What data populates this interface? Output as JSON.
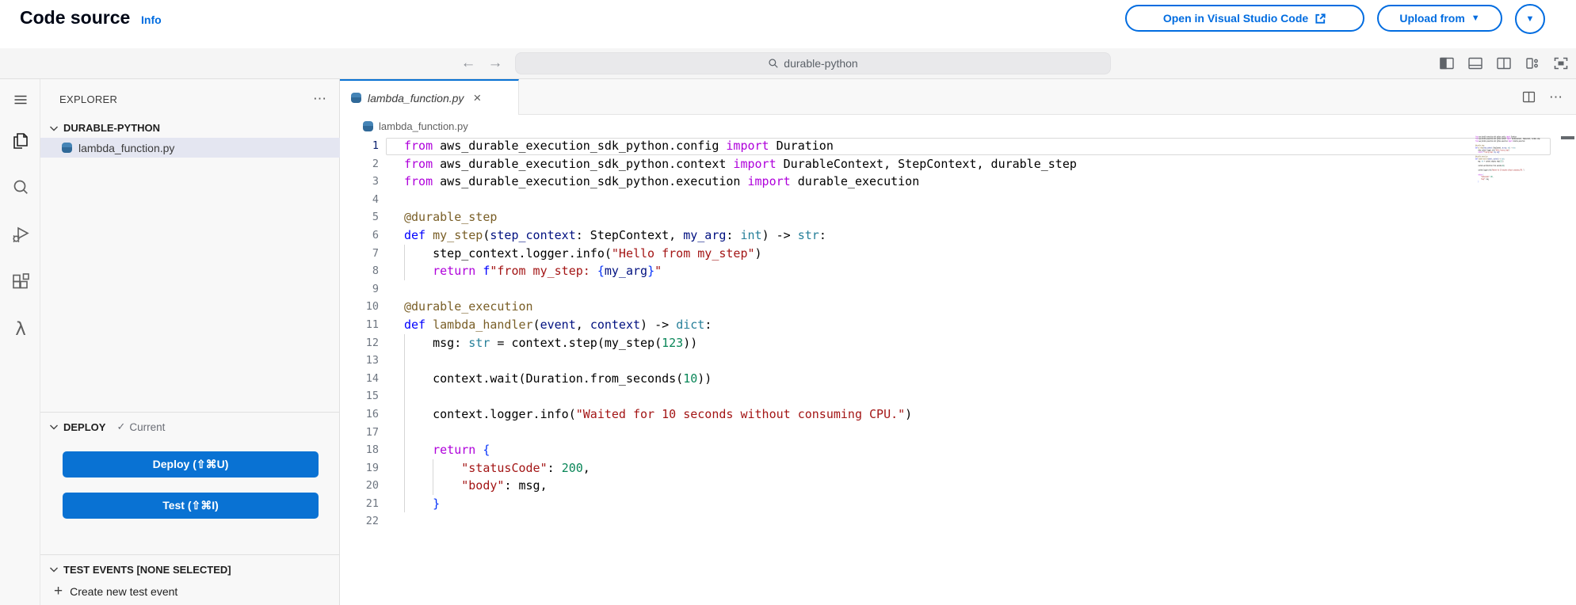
{
  "header": {
    "title": "Code source",
    "info": "Info",
    "open_vsc_label": "Open in Visual Studio Code",
    "upload_label": "Upload from"
  },
  "toolbar": {
    "search_value": "durable-python"
  },
  "icons": {
    "back_arrow": "←",
    "forward_arrow": "→",
    "more_horizontal": "⋯",
    "close": "×",
    "check": "✓",
    "plus": "+",
    "caret_down": "▼",
    "lambda": "λ"
  },
  "sidebar": {
    "explorer": "EXPLORER",
    "workspace": "DURABLE-PYTHON",
    "file": "lambda_function.py",
    "deploy_section": "DEPLOY",
    "deploy_status": "Current",
    "deploy_button": "Deploy (⇧⌘U)",
    "test_button": "Test (⇧⌘I)",
    "test_events_section": "TEST EVENTS [NONE SELECTED]",
    "create_test_event": "Create new test event"
  },
  "editor": {
    "tab": "lambda_function.py",
    "breadcrumb": "lambda_function.py",
    "palette": {
      "kc": "#AF00DB",
      "kw": "#0000FF",
      "fn": "#795E26",
      "ty": "#267F99",
      "pm": "#001080",
      "st": "#A31515",
      "nu": "#098658",
      "bk": "#0431FA",
      "pl": "#000000"
    },
    "lines": [
      {
        "n": 1,
        "current": true,
        "g": 0,
        "t": [
          [
            "kc",
            "from"
          ],
          [
            "pl",
            " aws_durable_execution_sdk_python.config "
          ],
          [
            "kc",
            "import"
          ],
          [
            "pl",
            " Duration"
          ]
        ]
      },
      {
        "n": 2,
        "g": 0,
        "t": [
          [
            "kc",
            "from"
          ],
          [
            "pl",
            " aws_durable_execution_sdk_python.context "
          ],
          [
            "kc",
            "import"
          ],
          [
            "pl",
            " DurableContext, StepContext, durable_step"
          ]
        ]
      },
      {
        "n": 3,
        "g": 0,
        "t": [
          [
            "kc",
            "from"
          ],
          [
            "pl",
            " aws_durable_execution_sdk_python.execution "
          ],
          [
            "kc",
            "import"
          ],
          [
            "pl",
            " durable_execution"
          ]
        ]
      },
      {
        "n": 4,
        "g": 0,
        "t": []
      },
      {
        "n": 5,
        "g": 0,
        "t": [
          [
            "fn",
            "@durable_step"
          ]
        ]
      },
      {
        "n": 6,
        "g": 0,
        "t": [
          [
            "kw",
            "def"
          ],
          [
            "pl",
            " "
          ],
          [
            "fn",
            "my_step"
          ],
          [
            "pl",
            "("
          ],
          [
            "pm",
            "step_context"
          ],
          [
            "pl",
            ": StepContext, "
          ],
          [
            "pm",
            "my_arg"
          ],
          [
            "pl",
            ": "
          ],
          [
            "ty",
            "int"
          ],
          [
            "pl",
            ") -> "
          ],
          [
            "ty",
            "str"
          ],
          [
            "pl",
            ":"
          ]
        ]
      },
      {
        "n": 7,
        "g": 1,
        "t": [
          [
            "pl",
            "    step_context.logger.info("
          ],
          [
            "st",
            "\"Hello from my_step\""
          ],
          [
            "pl",
            ")"
          ]
        ]
      },
      {
        "n": 8,
        "g": 1,
        "t": [
          [
            "pl",
            "    "
          ],
          [
            "kc",
            "return"
          ],
          [
            "pl",
            " "
          ],
          [
            "kw",
            "f"
          ],
          [
            "st",
            "\"from my_step: "
          ],
          [
            "bk",
            "{"
          ],
          [
            "pm",
            "my_arg"
          ],
          [
            "bk",
            "}"
          ],
          [
            "st",
            "\""
          ]
        ]
      },
      {
        "n": 9,
        "g": 0,
        "t": []
      },
      {
        "n": 10,
        "g": 0,
        "t": [
          [
            "fn",
            "@durable_execution"
          ]
        ]
      },
      {
        "n": 11,
        "g": 0,
        "t": [
          [
            "kw",
            "def"
          ],
          [
            "pl",
            " "
          ],
          [
            "fn",
            "lambda_handler"
          ],
          [
            "pl",
            "("
          ],
          [
            "pm",
            "event"
          ],
          [
            "pl",
            ", "
          ],
          [
            "pm",
            "context"
          ],
          [
            "pl",
            ") -> "
          ],
          [
            "ty",
            "dict"
          ],
          [
            "pl",
            ":"
          ]
        ]
      },
      {
        "n": 12,
        "g": 1,
        "t": [
          [
            "pl",
            "    msg: "
          ],
          [
            "ty",
            "str"
          ],
          [
            "pl",
            " = context.step(my_step("
          ],
          [
            "nu",
            "123"
          ],
          [
            "pl",
            "))"
          ]
        ]
      },
      {
        "n": 13,
        "g": 1,
        "t": []
      },
      {
        "n": 14,
        "g": 1,
        "t": [
          [
            "pl",
            "    context.wait(Duration.from_seconds("
          ],
          [
            "nu",
            "10"
          ],
          [
            "pl",
            "))"
          ]
        ]
      },
      {
        "n": 15,
        "g": 1,
        "t": []
      },
      {
        "n": 16,
        "g": 1,
        "t": [
          [
            "pl",
            "    context.logger.info("
          ],
          [
            "st",
            "\"Waited for 10 seconds without consuming CPU.\""
          ],
          [
            "pl",
            ")"
          ]
        ]
      },
      {
        "n": 17,
        "g": 1,
        "t": []
      },
      {
        "n": 18,
        "g": 1,
        "t": [
          [
            "pl",
            "    "
          ],
          [
            "kc",
            "return"
          ],
          [
            "pl",
            " "
          ],
          [
            "bk",
            "{"
          ]
        ]
      },
      {
        "n": 19,
        "g": 2,
        "t": [
          [
            "pl",
            "        "
          ],
          [
            "st",
            "\"statusCode\""
          ],
          [
            "pl",
            ": "
          ],
          [
            "nu",
            "200"
          ],
          [
            "pl",
            ","
          ]
        ]
      },
      {
        "n": 20,
        "g": 2,
        "t": [
          [
            "pl",
            "        "
          ],
          [
            "st",
            "\"body\""
          ],
          [
            "pl",
            ": msg,"
          ]
        ]
      },
      {
        "n": 21,
        "g": 1,
        "t": [
          [
            "pl",
            "    "
          ],
          [
            "bk",
            "}"
          ]
        ]
      },
      {
        "n": 22,
        "g": 0,
        "t": []
      }
    ]
  },
  "colors": {
    "accent_link": "#006ce0",
    "button_fill": "#0972d3",
    "tab_accent": "#0972d3",
    "selection_bg": "#e4e6f1"
  }
}
